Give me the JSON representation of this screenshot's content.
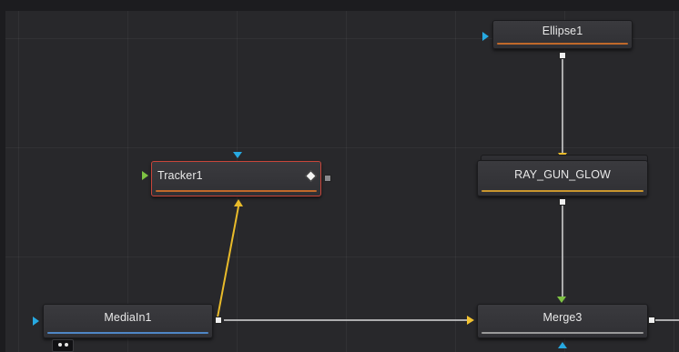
{
  "nodes": {
    "ellipse1": {
      "label": "Ellipse1",
      "bar_color": "#c0692a"
    },
    "tracker1": {
      "label": "Tracker1",
      "bar_color": "#c0692a"
    },
    "ray_gun_glow": {
      "label": "RAY_GUN_GLOW",
      "bar_color": "#c9962e"
    },
    "mediain1": {
      "label": "MediaIn1",
      "bar_color": "#4f86c6"
    },
    "merge3": {
      "label": "Merge3",
      "bar_color": "#9a9a9a"
    }
  },
  "colors": {
    "background_input": "#27a9e1",
    "foreground_input": "#f2c230",
    "effect_input": "#7ec243",
    "wire_connected": "#d9d9d9",
    "wire_tracker": "#e9bb2a",
    "selection_outline": "#c8453a"
  },
  "icons": {
    "keyframe": "diamond-keyframe-icon",
    "view_indicator": "view-dots-icon"
  }
}
